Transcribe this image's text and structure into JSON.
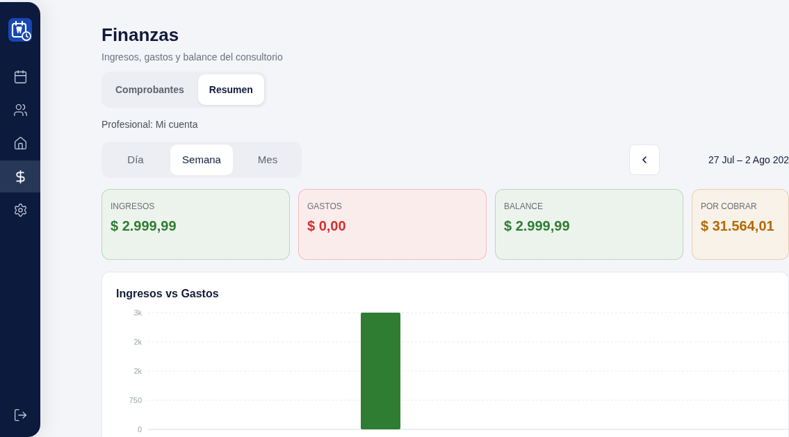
{
  "sidebar": {
    "items": [
      {
        "selected": false
      },
      {
        "selected": false
      },
      {
        "selected": false
      },
      {
        "selected": true
      },
      {
        "selected": false
      }
    ]
  },
  "header": {
    "title": "Finanzas",
    "subtitle": "Ingresos, gastos y balance del consultorio"
  },
  "tabs": [
    {
      "label": "Comprobantes",
      "selected": false
    },
    {
      "label": "Resumen",
      "selected": true
    }
  ],
  "filter": {
    "label": "Profesional: Mi cuenta"
  },
  "period_tabs": [
    {
      "label": "Día",
      "selected": false
    },
    {
      "label": "Semana",
      "selected": true
    },
    {
      "label": "Mes",
      "selected": false
    }
  ],
  "date_nav": {
    "range": "27 Jul – 2 Ago 202"
  },
  "cards": [
    {
      "label": "INGRESOS",
      "value": "$ 2.999,99",
      "color": "#2e7d32"
    },
    {
      "label": "GASTOS",
      "value": "$ 0,00",
      "color": "#d32f2f"
    },
    {
      "label": "BALANCE",
      "value": "$ 2.999,99",
      "color": "#2e7d32"
    },
    {
      "label": "POR COBRAR",
      "value": "$ 31.564,01",
      "color": "#b26a00"
    }
  ],
  "chart": {
    "chart_data": {
      "type": "bar",
      "title": "Ingresos vs Gastos",
      "grid": true,
      "ylim": [
        0,
        3000
      ],
      "yticks": [
        0,
        750,
        {
          "value": 1500,
          "label": "2k"
        },
        {
          "value": 2250,
          "label": "2k"
        },
        {
          "value": 3000,
          "label": "3k"
        }
      ],
      "series": [
        {
          "color": "#2e7d32",
          "values": [
            null,
            3000,
            null,
            null
          ]
        }
      ]
    }
  }
}
